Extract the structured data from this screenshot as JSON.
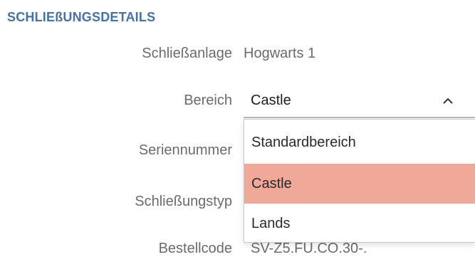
{
  "section": {
    "title": "SCHLIEßUNGSDETAILS"
  },
  "fields": {
    "locking_system": {
      "label": "Schließanlage",
      "value": "Hogwarts 1"
    },
    "area": {
      "label": "Bereich",
      "value": "Castle"
    },
    "serial_number": {
      "label": "Seriennummer"
    },
    "locking_type": {
      "label": "Schließungstyp"
    },
    "order_code": {
      "label": "Bestellcode",
      "value": "SV-Z5.FU.CO.30-."
    }
  },
  "area_dropdown": {
    "options": [
      "Standardbereich",
      "Castle",
      "Lands"
    ],
    "selected_index": 1
  },
  "colors": {
    "section_title": "#4472a8",
    "selected_option": "#f0a898"
  },
  "icons": {
    "select_toggle": "chevron-up-icon"
  }
}
